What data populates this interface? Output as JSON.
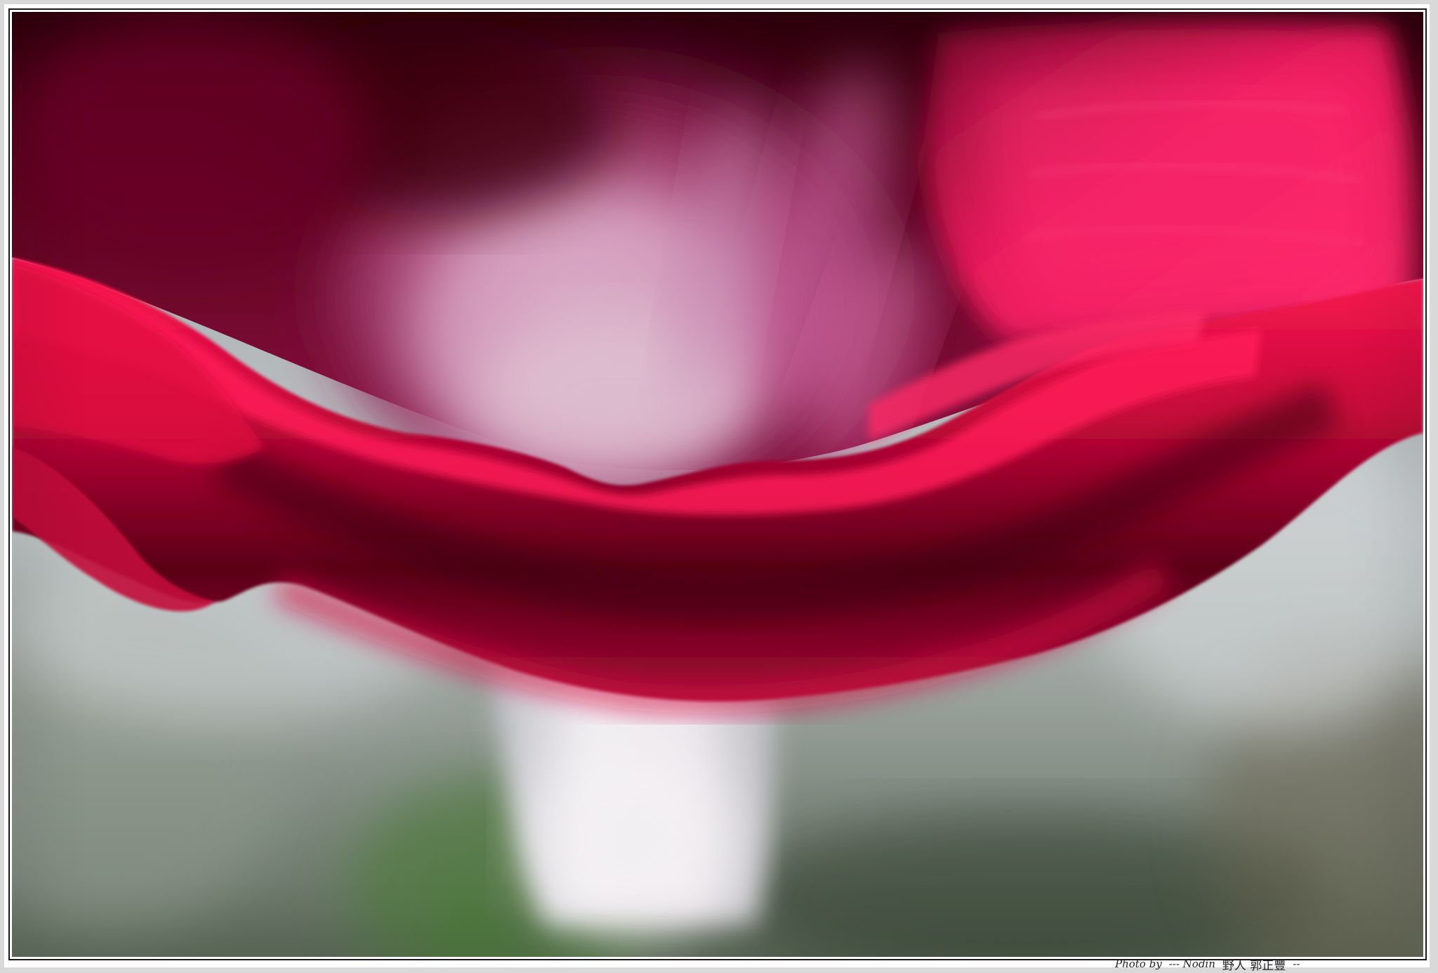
{
  "photo": {
    "subject": "",
    "colors": {
      "petal_dark": "#4a0012",
      "petal_mid": "#b30a34",
      "petal_bright": "#ff1050",
      "petal_highlight": "#ff3a7a",
      "throat_pink": "#c9719f",
      "throat_light": "#e6c6d8",
      "tube_white": "#eeeaee",
      "background_gray": "#b7bcbf",
      "background_green": "#5f7d52"
    }
  },
  "caption": {
    "photo_by": "Photo by",
    "prefix": "--- Nodin",
    "name_cn": "野人  郭正豐",
    "suffix": "--"
  }
}
